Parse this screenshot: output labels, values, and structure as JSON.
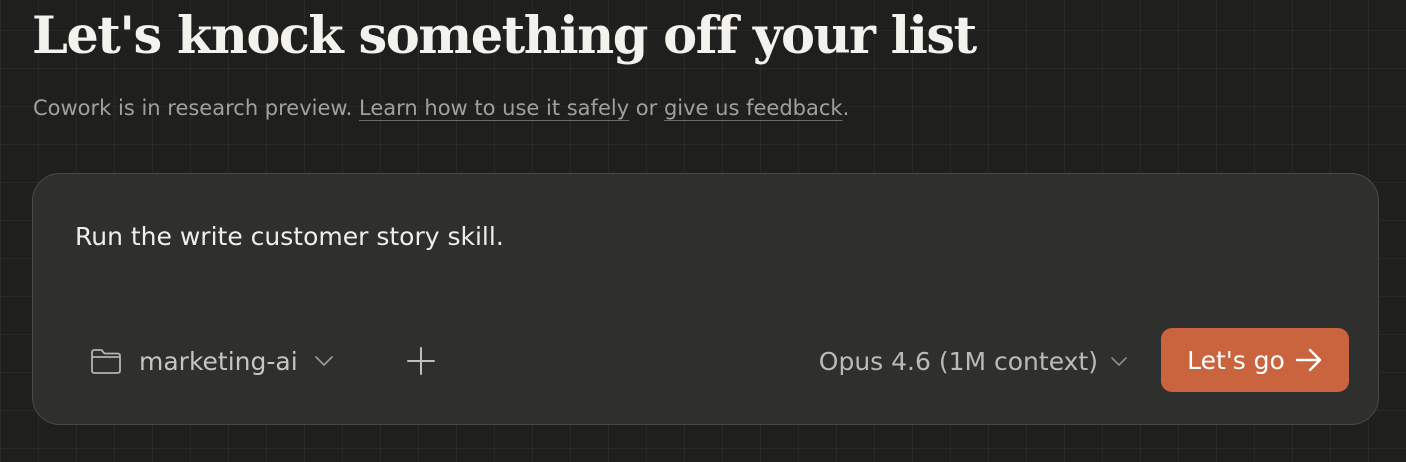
{
  "header": {
    "title": "Let's knock something off your list",
    "subtitle_prefix": "Cowork is in research preview. ",
    "learn_link": "Learn how to use it safely",
    "subtitle_middle": " or ",
    "feedback_link": "give us feedback",
    "subtitle_suffix": "."
  },
  "composer": {
    "prompt": "Run the write customer story skill.",
    "folder": {
      "icon": "folder-icon",
      "label": "marketing-ai",
      "chevron_icon": "chevron-down-icon"
    },
    "add_icon": "plus-icon",
    "model": {
      "label": "Opus 4.6 (1M context)",
      "chevron_icon": "chevron-down-icon"
    },
    "submit": {
      "label": "Let's go",
      "icon": "arrow-right-icon"
    }
  },
  "colors": {
    "background": "#1f1f1e",
    "composer_background": "#2f2f2e",
    "accent": "#c9643f"
  }
}
